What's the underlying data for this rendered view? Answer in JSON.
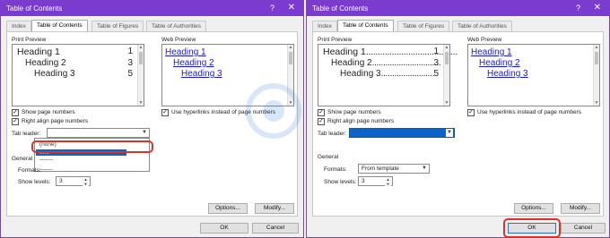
{
  "dialogs": [
    {
      "title": "Table of Contents",
      "help_label": "?",
      "close_label": "✕",
      "tabs": [
        "Index",
        "Table of Contents",
        "Table of Figures",
        "Table of Authorities"
      ],
      "active_tab": "Table of Contents",
      "print_preview": {
        "label": "Print Preview",
        "entries": [
          {
            "text": "Heading 1",
            "page": "1"
          },
          {
            "text": "Heading 2",
            "page": "3"
          },
          {
            "text": "Heading 3",
            "page": "5"
          }
        ]
      },
      "web_preview": {
        "label": "Web Preview",
        "entries": [
          "Heading 1",
          "Heading 2",
          "Heading 3"
        ]
      },
      "show_page_numbers": {
        "label": "Show page numbers",
        "checked": true
      },
      "right_align": {
        "label": "Right align page numbers",
        "checked": true
      },
      "use_hyperlinks": {
        "label": "Use hyperlinks instead of page numbers",
        "checked": true
      },
      "tab_leader": {
        "label": "Tab leader:",
        "value": "",
        "open": true,
        "options": [
          "(none)",
          "......",
          "-------",
          "____"
        ],
        "selected_index": 1
      },
      "general": {
        "label": "General"
      },
      "formats": {
        "label": "Formats:",
        "value": ""
      },
      "show_levels": {
        "label": "Show levels:",
        "value": "3"
      },
      "options_button": "Options...",
      "modify_button": "Modify...",
      "ok_button": "OK",
      "cancel_button": "Cancel"
    },
    {
      "title": "Table of Contents",
      "help_label": "?",
      "close_label": "✕",
      "tabs": [
        "Index",
        "Table of Contents",
        "Table of Figures",
        "Table of Authorities"
      ],
      "active_tab": "Table of Contents",
      "print_preview": {
        "label": "Print Preview",
        "entries": [
          {
            "text": "Heading 1",
            "dots": ".......................................",
            "page": "1"
          },
          {
            "text": "Heading 2",
            "dots": "...............................",
            "page": "3"
          },
          {
            "text": "Heading 3",
            "dots": "........................",
            "page": "5"
          }
        ]
      },
      "web_preview": {
        "label": "Web Preview",
        "entries": [
          "Heading 1",
          "Heading 2",
          "Heading 3"
        ]
      },
      "show_page_numbers": {
        "label": "Show page numbers",
        "checked": true
      },
      "right_align": {
        "label": "Right align page numbers",
        "checked": true
      },
      "use_hyperlinks": {
        "label": "Use hyperlinks instead of page numbers",
        "checked": true
      },
      "tab_leader": {
        "label": "Tab leader:",
        "value": "",
        "open": false
      },
      "general": {
        "label": "General"
      },
      "formats": {
        "label": "Formats:",
        "value": "From template"
      },
      "show_levels": {
        "label": "Show levels:",
        "value": "3"
      },
      "options_button": "Options...",
      "modify_button": "Modify...",
      "ok_button": "OK",
      "cancel_button": "Cancel"
    }
  ],
  "colors": {
    "titlebar": "#7b3ad0",
    "selection": "#0a64c8",
    "hyperlink": "#1a1ad6",
    "highlight_ring": "#d9342b"
  }
}
